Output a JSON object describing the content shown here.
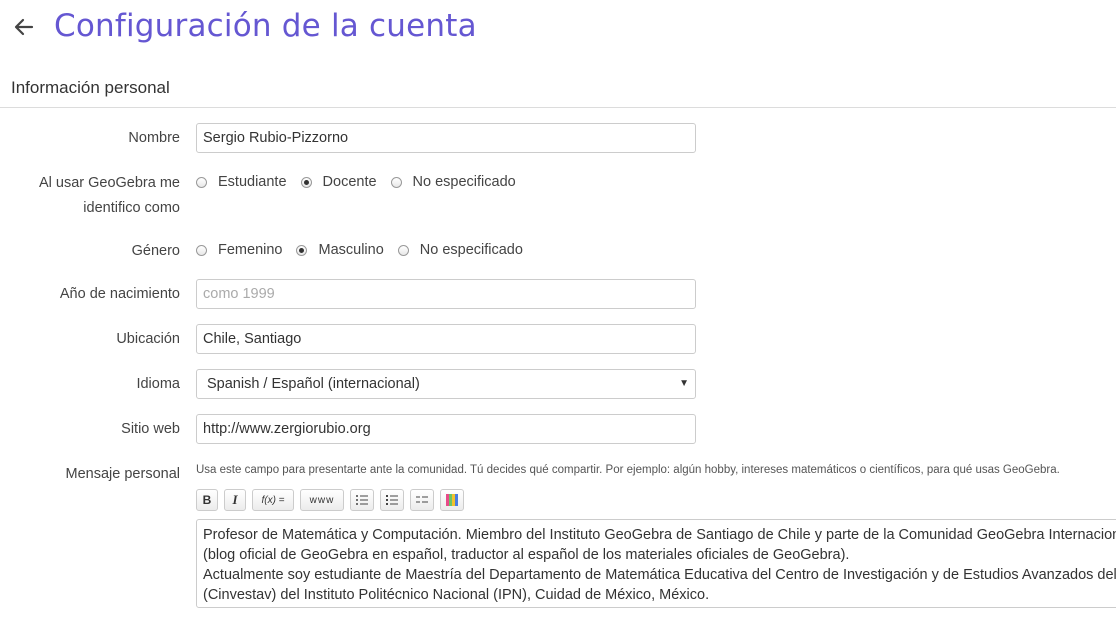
{
  "header": {
    "title": "Configuración de la cuenta"
  },
  "section": {
    "title": "Información personal"
  },
  "form": {
    "name": {
      "label": "Nombre",
      "value": "Sergio Rubio-Pizzorno"
    },
    "role": {
      "label": "Al usar GeoGebra me identifico como",
      "options": [
        "Estudiante",
        "Docente",
        "No especificado"
      ],
      "selected": "Docente"
    },
    "gender": {
      "label": "Género",
      "options": [
        "Femenino",
        "Masculino",
        "No especificado"
      ],
      "selected": "Masculino"
    },
    "birth_year": {
      "label": "Año de nacimiento",
      "value": "",
      "placeholder": "como 1999"
    },
    "location": {
      "label": "Ubicación",
      "value": "Chile, Santiago"
    },
    "language": {
      "label": "Idioma",
      "value": "Spanish / Español (internacional)"
    },
    "website": {
      "label": "Sitio web",
      "value": "http://www.zergiorubio.org"
    },
    "message": {
      "label": "Mensaje personal",
      "hint": "Usa este campo para presentarte ante la comunidad. Tú decides qué compartir. Por ejemplo: algún hobby, intereses matemáticos o científicos, para qué usas GeoGebra.",
      "toolbar": {
        "bold": "B",
        "italic": "I",
        "formula": "f(x) =",
        "link": "www"
      },
      "lines": [
        "Profesor de Matemática y Computación. Miembro del Instituto GeoGebra de Santiago de Chile y parte de la Comunidad GeoGebra Internacional",
        "(blog oficial de GeoGebra en español, traductor al español de los materiales oficiales de GeoGebra).",
        "Actualmente soy estudiante de Maestría del Departamento de Matemática Educativa del Centro de Investigación y de Estudios Avanzados del IPN",
        "(Cinvestav) del Instituto Politécnico Nacional (IPN), Cuidad de México, México."
      ]
    }
  },
  "colors": {
    "accent": "#6557d2",
    "text": "#333333",
    "border": "#cccccc"
  },
  "icons": [
    "arrow-left-icon",
    "bullet-list-icon",
    "numbered-list-icon",
    "indent-list-icon",
    "color-picker-icon"
  ]
}
